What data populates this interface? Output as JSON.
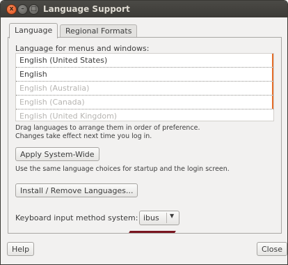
{
  "window": {
    "title": "Language Support",
    "close_glyph": "x",
    "min_glyph": "–",
    "max_glyph": "□"
  },
  "tabs": [
    {
      "label": "Language",
      "active": true
    },
    {
      "label": "Regional Formats",
      "active": false
    }
  ],
  "language_section": {
    "heading": "Language for menus and windows:",
    "languages": [
      {
        "label": "English (United States)",
        "enabled": true
      },
      {
        "label": "English",
        "enabled": true
      },
      {
        "label": "English (Australia)",
        "enabled": false
      },
      {
        "label": "English (Canada)",
        "enabled": false
      },
      {
        "label": "English (United Kingdom)",
        "enabled": false
      }
    ],
    "hint_line1": "Drag languages to arrange them in order of preference.",
    "hint_line2": "Changes take effect next time you log in.",
    "apply_button": "Apply System-Wide",
    "apply_hint": "Use the same language choices for startup and the login screen.",
    "install_button": "Install / Remove Languages...",
    "keyboard_label": "Keyboard input method system:",
    "keyboard_value": "ibus",
    "dropdown_arrow": "▼"
  },
  "footer": {
    "help_button": "Help",
    "close_button": "Close"
  },
  "colors": {
    "accent": "#e66e2a",
    "underline_mark": "#7a1620"
  }
}
